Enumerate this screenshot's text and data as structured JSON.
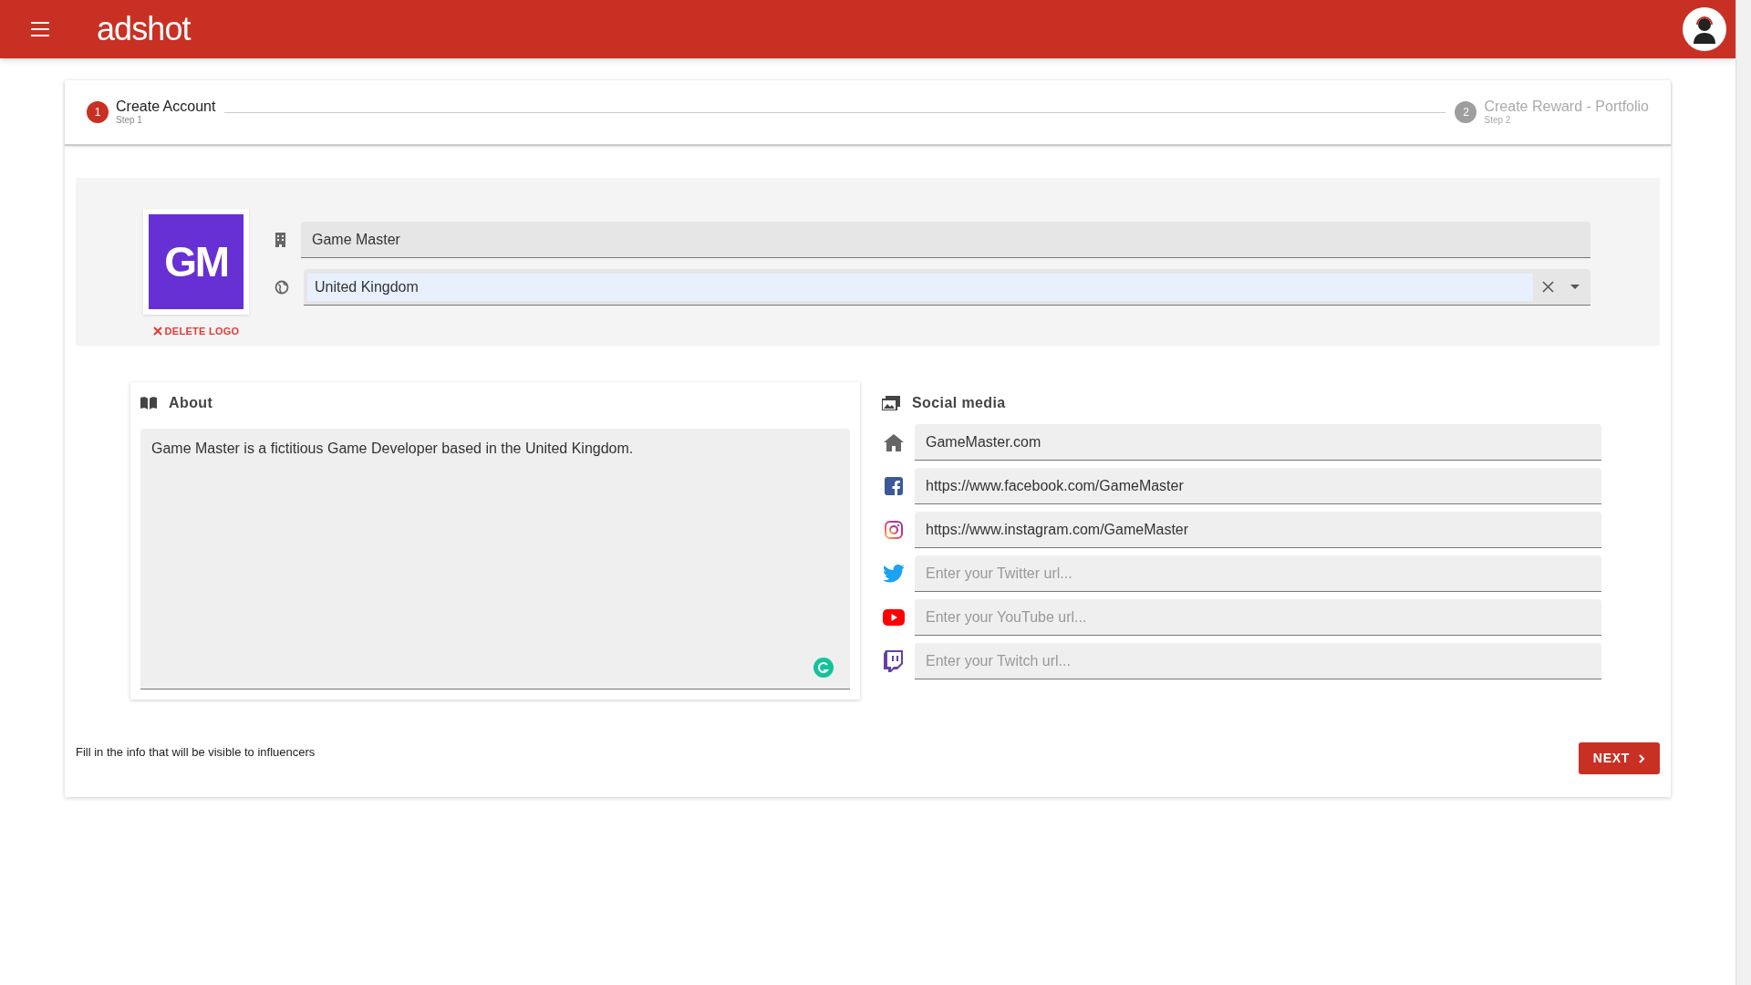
{
  "header": {
    "brand": "adshot"
  },
  "stepper": [
    {
      "number": "1",
      "label": "Create Account",
      "sublabel": "Step 1",
      "selected": true
    },
    {
      "number": "2",
      "label": "Create Reward - Portfolio",
      "sublabel": "Step 2",
      "selected": false
    }
  ],
  "company": {
    "logo_text": "GM",
    "delete_logo": "DELETE LOGO",
    "name": {
      "value": "Game Master"
    },
    "country": {
      "value": "United Kingdom",
      "autofilled": true
    }
  },
  "about": {
    "title": "About",
    "text": "Game Master is a fictitious Game Developer based in the United Kingdom."
  },
  "social_media": {
    "title": "Social media",
    "links": [
      {
        "kind": "website",
        "value": "GameMaster.com"
      },
      {
        "kind": "facebook",
        "value": "https://www.facebook.com/GameMaster"
      },
      {
        "kind": "instagram",
        "value": "https://www.instagram.com/GameMaster"
      },
      {
        "kind": "twitter",
        "placeholder": "Enter your Twitter url..."
      },
      {
        "kind": "youtube",
        "placeholder": "Enter your YouTube url..."
      },
      {
        "kind": "twitch",
        "placeholder": "Enter your Twitch url..."
      }
    ]
  },
  "footer": {
    "hint": "Fill in the info that will be visible to influencers",
    "next_button": "NEXT"
  }
}
